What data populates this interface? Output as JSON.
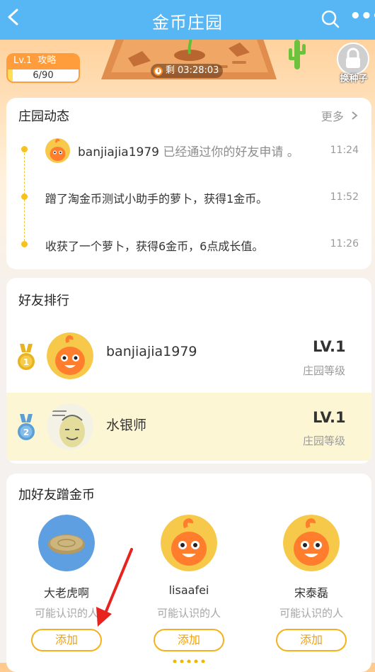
{
  "header": {
    "title": "金币庄园",
    "back_icon": "back-chevron-icon",
    "search_icon": "search-icon",
    "more_icon": "more-dots-icon",
    "more_glyph": "•••"
  },
  "banner": {
    "level_label": "Lv.1",
    "guide_label": "攻略",
    "progress_text": "6/90",
    "progress_fraction": 0.0667,
    "timer_prefix": "剩",
    "timer_value": "03:28:03",
    "seed_button_label": "换种子",
    "seed_icon": "lock-icon"
  },
  "news": {
    "title": "庄园动态",
    "more_label": "更多",
    "items": [
      {
        "name": "banjiajia1979",
        "text": "已经通过你的好友申请 。",
        "time": "11:24"
      },
      {
        "text": "蹭了淘金币测试小助手的萝卜，获得1金币。",
        "time": "11:52"
      },
      {
        "text": "收获了一个萝卜，获得6金币，6点成长值。",
        "time": "11:26"
      }
    ]
  },
  "ranking": {
    "title": "好友排行",
    "rows": [
      {
        "rank": "1",
        "name": "banjiajia1979",
        "level": "LV.1",
        "level_label": "庄园等级",
        "medal_color": "#e9b320"
      },
      {
        "rank": "2",
        "name": "水银师",
        "level": "LV.1",
        "level_label": "庄园等级",
        "medal_color": "#5b9fd6"
      }
    ]
  },
  "add_friends": {
    "title": "加好友蹭金币",
    "friends": [
      {
        "name": "大老虎啊",
        "subtitle": "可能认识的人",
        "button": "添加"
      },
      {
        "name": "lisaafei",
        "subtitle": "可能认识的人",
        "button": "添加"
      },
      {
        "name": "宋泰磊",
        "subtitle": "可能认识的人",
        "button": "添加"
      }
    ]
  },
  "colors": {
    "header": "#56b7f4",
    "accent": "#f5b11c",
    "highlight_row": "#fdf6d5",
    "annotation_arrow": "#e8231f"
  }
}
